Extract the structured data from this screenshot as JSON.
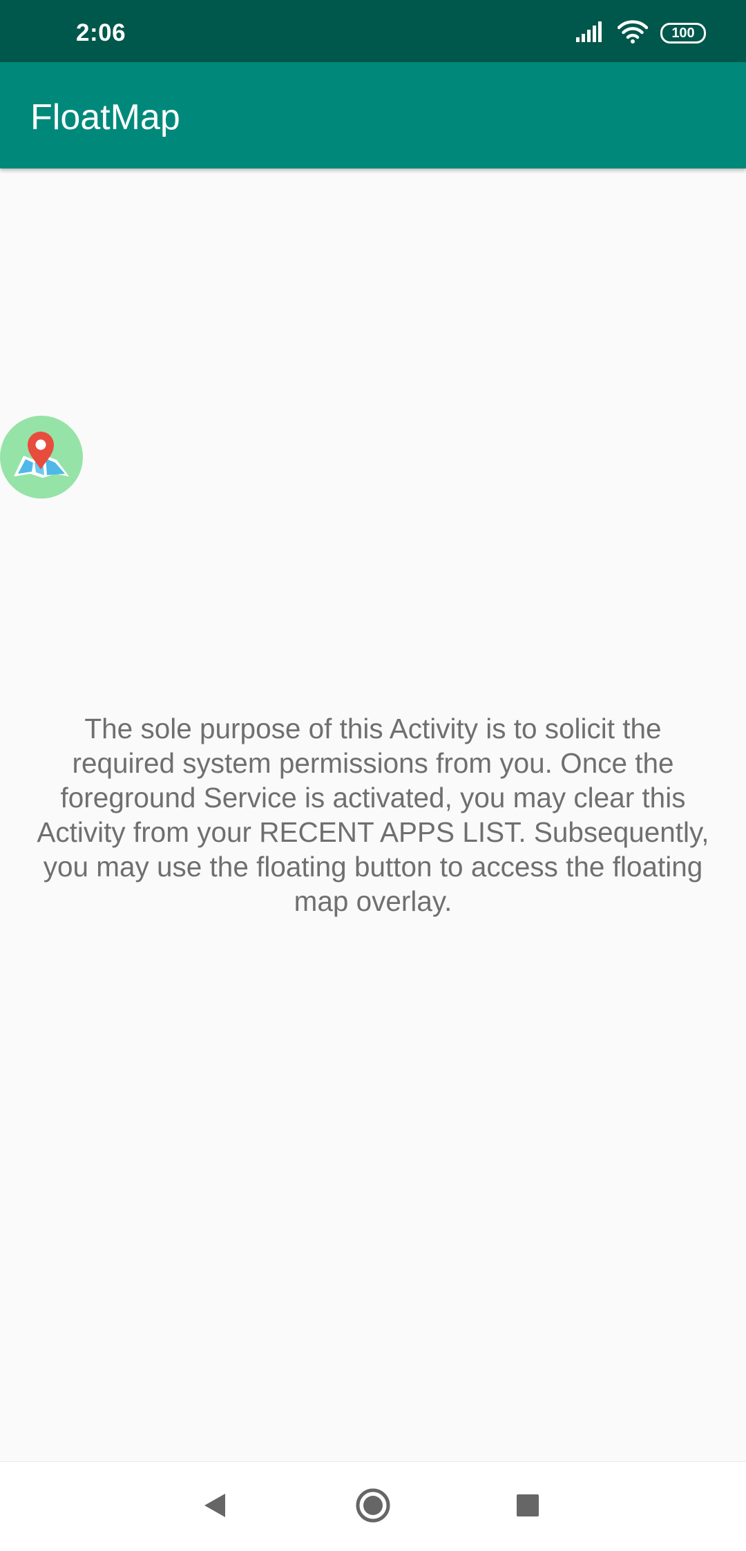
{
  "status_bar": {
    "time": "2:06",
    "battery_level": "100",
    "icons": [
      "signal-icon",
      "wifi-icon",
      "battery-icon"
    ]
  },
  "app_bar": {
    "title": "FloatMap"
  },
  "floating_button": {
    "icon": "map-pin-icon",
    "background_color": "#96e3a7"
  },
  "main": {
    "info_text": "The sole purpose of this Activity is to solicit the required system permissions from you. Once the foreground Service is activated, you may clear this Activity from your RECENT APPS LIST. Subsequently, you may use the floating button to access the floating map overlay."
  },
  "nav_bar": {
    "buttons": [
      "back-icon",
      "home-icon",
      "recents-icon"
    ]
  },
  "colors": {
    "status_bar": "#00574b",
    "app_bar": "#00897b",
    "background": "#fafafa",
    "text": "#6f6f6f"
  }
}
